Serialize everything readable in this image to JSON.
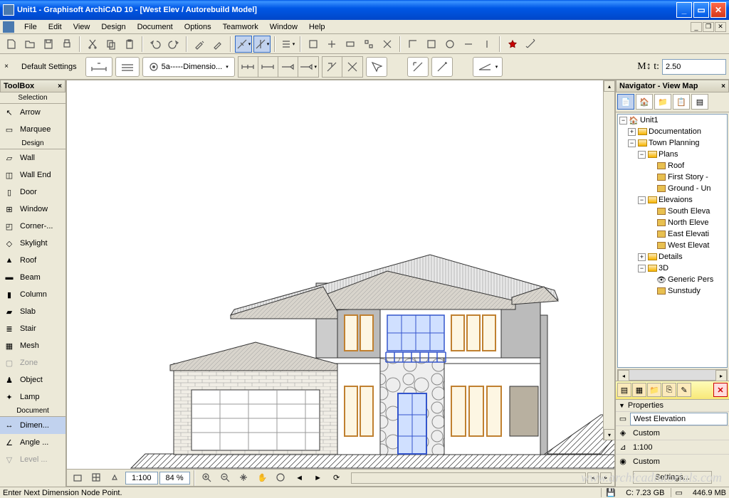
{
  "titlebar": {
    "text": "Unit1 - Graphisoft ArchiCAD 10 - [West Elev  / Autorebuild Model]"
  },
  "menu": [
    "File",
    "Edit",
    "View",
    "Design",
    "Document",
    "Options",
    "Teamwork",
    "Window",
    "Help"
  ],
  "options": {
    "default_label": "Default Settings",
    "dim_combo": "5a-----Dimensio...",
    "m_field_label": "M↕ t:",
    "m_field_value": "2.50"
  },
  "toolbox": {
    "title": "ToolBox",
    "sections": {
      "selection": "Selection",
      "design": "Design",
      "document": "Document"
    },
    "selection_items": [
      "Arrow",
      "Marquee"
    ],
    "design_items": [
      "Wall",
      "Wall End",
      "Door",
      "Window",
      "Corner-...",
      "Skylight",
      "Roof",
      "Beam",
      "Column",
      "Slab",
      "Stair",
      "Mesh",
      "Zone",
      "Object",
      "Lamp"
    ],
    "document_items": [
      "Dimen...",
      "Angle ...",
      "Level ..."
    ]
  },
  "canvas_bottom": {
    "scale": "1:100",
    "zoom": "84 %"
  },
  "navigator": {
    "title": "Navigator - View Map",
    "tree": {
      "root": "Unit1",
      "documentation": "Documentation",
      "town_planning": "Town Planning",
      "plans": "Plans",
      "plans_items": [
        "Roof",
        "First Story -",
        "Ground - Un"
      ],
      "elevations": "Elevaions",
      "elev_items": [
        "South Eleva",
        "North Eleve",
        "East Elevati",
        "West Elevat"
      ],
      "details": "Details",
      "3d": "3D",
      "3d_items": [
        "Generic Pers",
        "Sunstudy"
      ]
    },
    "props": {
      "header": "Properties",
      "name": "West Elevation",
      "custom1": "Custom",
      "scale": "1:100",
      "custom2": "Custom",
      "settings_btn": "Settings..."
    }
  },
  "status": {
    "hint": "Enter Next Dimension Node Point.",
    "disk_c": "C: 7.23 GB",
    "mem": "446.9 MB"
  },
  "watermark": "www.archicadtutorials.com"
}
